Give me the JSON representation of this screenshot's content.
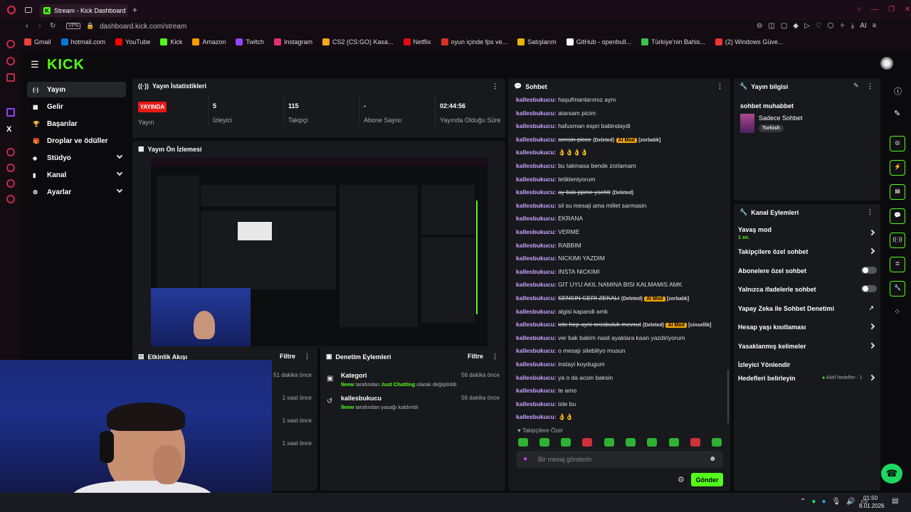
{
  "browser": {
    "tab_title": "Stream - Kick Dashboard",
    "vpn": "VPN",
    "url": "dashboard.kick.com/stream",
    "bookmarks": [
      "Gmail",
      "hotmail.com",
      "YouTube",
      "Kick",
      "Amazon",
      "Twitch",
      "Instagram",
      "CS2 (CS:GO) Kasa...",
      "Netflix",
      "oyun içinde fps ve...",
      "Satışlarım",
      "GitHub - openbull...",
      "Türkiye'nin Bahis...",
      "(2) Windows Güve..."
    ]
  },
  "sidebar": {
    "logo": "KICK",
    "items": [
      {
        "label": "Yayın",
        "icon": "broadcast-icon"
      },
      {
        "label": "Gelir",
        "icon": "grid-icon"
      },
      {
        "label": "Başarılar",
        "icon": "trophy-icon"
      },
      {
        "label": "Droplar ve ödüller",
        "icon": "gift-icon"
      },
      {
        "label": "Stüdyo",
        "icon": "layers-icon"
      },
      {
        "label": "Kanal",
        "icon": "bars-icon"
      },
      {
        "label": "Ayarlar",
        "icon": "gear-icon"
      }
    ]
  },
  "stats": {
    "title": "Yayın İstatistikleri",
    "live": "YAYINDA",
    "status_label": "Yayın",
    "cells": [
      {
        "value": "5",
        "label": "İzleyici"
      },
      {
        "value": "115",
        "label": "Takipçi"
      },
      {
        "value": "-",
        "label": "Abone Sayısı"
      },
      {
        "value": "02:44:56",
        "label": "Yayında Olduğu Süre"
      }
    ]
  },
  "preview": {
    "title": "Yayın Ön İzlemesi"
  },
  "activity": {
    "title": "Etkinlik Akışı",
    "filter": "Filtre",
    "times": [
      "51 dakika önce",
      "1 saat önce",
      "1 saat önce",
      "1 saat önce"
    ]
  },
  "moderation": {
    "title": "Denetim Eylemleri",
    "filter": "Filtre",
    "entries": [
      {
        "title": "Kategori",
        "time": "56 dakika önce",
        "who": "lleew",
        "mid": " tarafından ",
        "target": "Just Chatting",
        "rest": " olarak değiştirildi"
      },
      {
        "title": "kallesbukucu",
        "time": "56 dakika önce",
        "who": "lleew",
        "mid": " tarafından yasağı kaldırıldı",
        "target": "",
        "rest": ""
      }
    ]
  },
  "chat": {
    "title": "Sohbet",
    "user": "kallesbukucu:",
    "messages": [
      {
        "text": "haşufmanlarımız aynı"
      },
      {
        "text": "atarsam picim"
      },
      {
        "text": "hafusman espri babindaydi"
      },
      {
        "text": "sensin picce",
        "deleted": "(Deleted)",
        "ai": "AI Mod",
        "tag": "[zorbalık]"
      },
      {
        "text": "👌👌👌👌"
      },
      {
        "text": "bu takmasa bende zorlamam"
      },
      {
        "text": "tetikleniyorum"
      },
      {
        "text": "ay bak ppme ysehtt",
        "deleted": "(Deleted)"
      },
      {
        "text": "sil su mesaji ama millet sarmasin"
      },
      {
        "text": "EKRANA"
      },
      {
        "text": "VERME"
      },
      {
        "text": "RABBIM"
      },
      {
        "text": "NICKIMI YAZDIM"
      },
      {
        "text": "INSTA NICKIMI"
      },
      {
        "text": "GIT UYU AKIL NAMINA BISI KALMAMIS AMK"
      },
      {
        "text": "SENSIN GERI ZEKALI",
        "deleted": "(Deleted)",
        "ai": "AI Mod",
        "tag": "[zorbalık]"
      },
      {
        "text": "algisi kapandi amk"
      },
      {
        "text": "icte hep ayni orosbuluk mevcut",
        "deleted": "(Deleted)",
        "ai": "AI Mod",
        "tag": "[cinsellik]"
      },
      {
        "text": "ver bak bakim nasil ayaklara kaan yazdiriyorum"
      },
      {
        "text": "o mesajı silebiliyo musun"
      },
      {
        "text": "instayi koydugum"
      },
      {
        "text": "ya o da acsin baksin"
      },
      {
        "text": "te amo"
      },
      {
        "text": "iste bu"
      },
      {
        "text": "👌👌"
      }
    ],
    "followers_only": "Takipçilere Özel",
    "placeholder": "Bir mesaj gönderin",
    "send": "Gönder"
  },
  "stream_info": {
    "title": "Yayın bilgisi",
    "stream_title": "sohbet muhabbet",
    "category": "Sadece Sohbet",
    "tag": "Turkish"
  },
  "channel_actions": {
    "title": "Kanal Eylemleri",
    "slow_mode": "Yavaş mod",
    "slow_value": "1 sn.",
    "rows": [
      {
        "label": "Takipçilere özel sohbet",
        "control": "arrow"
      },
      {
        "label": "Abonelere özel sohbet",
        "control": "toggle"
      },
      {
        "label": "Yalnızca ifadelerle sohbet",
        "control": "toggle"
      },
      {
        "label": "Yapay Zeka ile Sohbet Denetimi",
        "control": "external"
      },
      {
        "label": "Hesap yaşı kısıtlaması",
        "control": "arrow"
      },
      {
        "label": "Yasaklanmış kelimeler",
        "control": "arrow"
      },
      {
        "label": "İzleyici Yönlendir",
        "control": "none"
      }
    ],
    "targets": "Hedefleri belirleyin",
    "targets_status": "Aktif hedefler - 1"
  },
  "taskbar": {
    "time": "01:50",
    "date": "8.01.2026"
  },
  "colors": {
    "accent": "#53fc18",
    "live": "#e91916",
    "username": "#c9a3ff",
    "ai": "#f0a500"
  }
}
